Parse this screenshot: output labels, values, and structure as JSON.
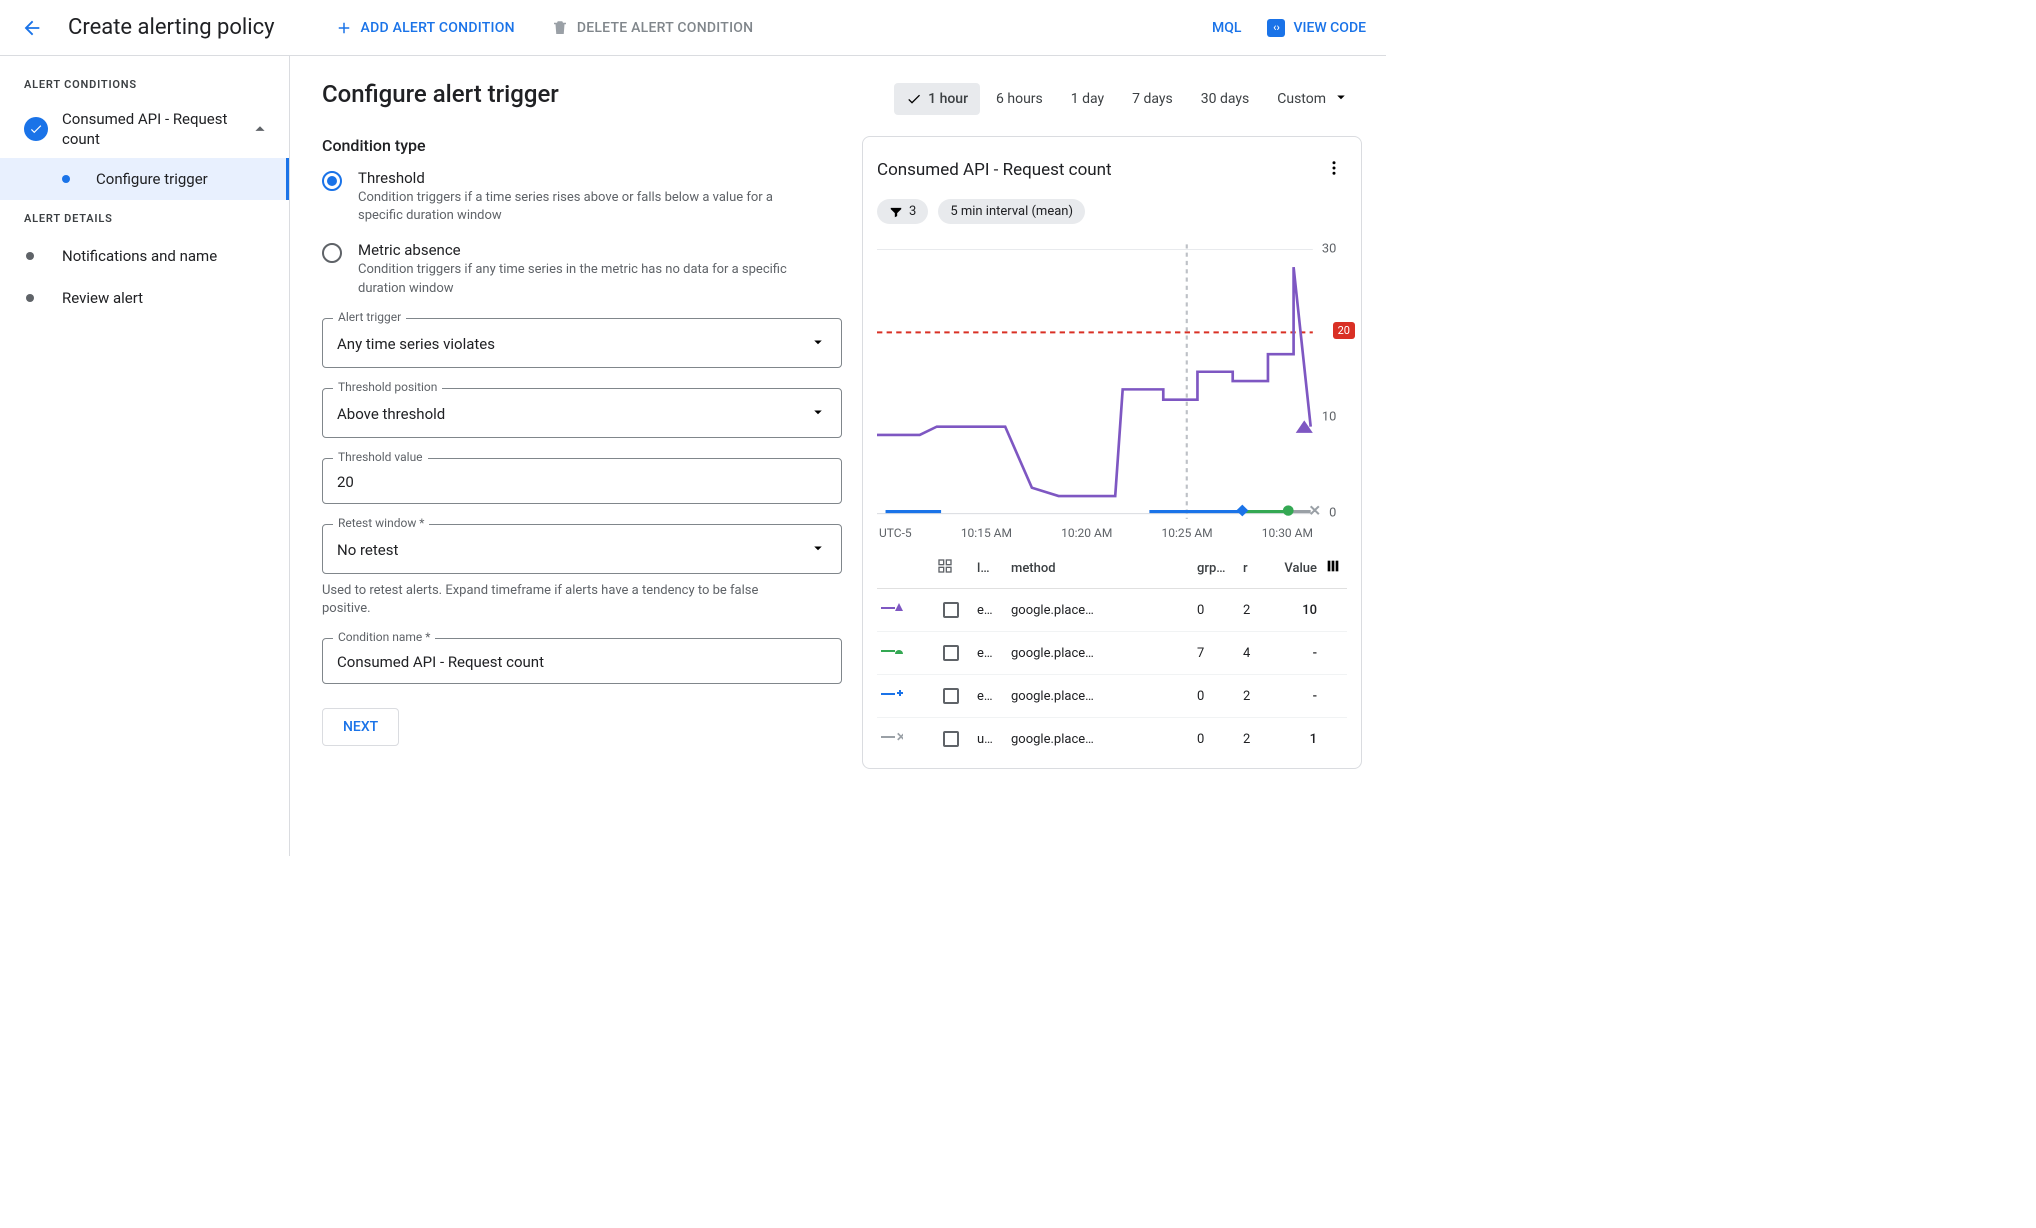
{
  "header": {
    "title": "Create alerting policy",
    "add_condition": "ADD ALERT CONDITION",
    "delete_condition": "DELETE ALERT CONDITION",
    "mql": "MQL",
    "view_code": "VIEW CODE"
  },
  "sidebar": {
    "conditions_heading": "ALERT CONDITIONS",
    "condition_title": "Consumed API - Request count",
    "configure_trigger": "Configure trigger",
    "details_heading": "ALERT DETAILS",
    "notifications_name": "Notifications and name",
    "review_alert": "Review alert"
  },
  "form": {
    "heading": "Configure alert trigger",
    "condition_type_heading": "Condition type",
    "threshold_label": "Threshold",
    "threshold_desc": "Condition triggers if a time series rises above or falls below a value for a specific duration window",
    "absence_label": "Metric absence",
    "absence_desc": "Condition triggers if any time series in the metric has no data for a specific duration window",
    "fields": {
      "alert_trigger": {
        "label": "Alert trigger",
        "value": "Any time series violates"
      },
      "threshold_position": {
        "label": "Threshold position",
        "value": "Above threshold"
      },
      "threshold_value": {
        "label": "Threshold value",
        "value": "20"
      },
      "retest": {
        "label": "Retest window *",
        "value": "No retest",
        "helper": "Used to retest alerts. Expand timeframe if alerts have a tendency to be false positive."
      },
      "condition_name": {
        "label": "Condition name *",
        "value": "Consumed API - Request count"
      }
    },
    "next": "NEXT"
  },
  "time_tabs": [
    "1 hour",
    "6 hours",
    "1 day",
    "7 days",
    "30 days"
  ],
  "time_custom": "Custom",
  "chart_panel": {
    "title": "Consumed API - Request count",
    "filter_count": "3",
    "interval_chip": "5 min interval (mean)",
    "timezone": "UTC-5",
    "x_ticks": [
      "10:15 AM",
      "10:20 AM",
      "10:25 AM",
      "10:30 AM"
    ],
    "y_ticks": [
      "30",
      "20",
      "10",
      "0"
    ],
    "threshold_badge": "20",
    "columns": {
      "c1": "l…",
      "c2": "method",
      "c3": "grp…",
      "c4": "r",
      "c5": "Value"
    },
    "rows": [
      {
        "marker_color": "#7e57c2",
        "marker_shape": "tri",
        "name": "e…",
        "method": "google.place…",
        "grp": "0",
        "r": "2",
        "value": "10"
      },
      {
        "marker_color": "#34a853",
        "marker_shape": "semi",
        "name": "e…",
        "method": "google.place…",
        "grp": "7",
        "r": "4",
        "value": "-"
      },
      {
        "marker_color": "#1a73e8",
        "marker_shape": "plus",
        "name": "e…",
        "method": "google.place…",
        "grp": "0",
        "r": "2",
        "value": "-"
      },
      {
        "marker_color": "#9aa0a6",
        "marker_shape": "x",
        "name": "u…",
        "method": "google.place…",
        "grp": "0",
        "r": "2",
        "value": "1"
      }
    ]
  },
  "chart_data": {
    "type": "line",
    "title": "Consumed API - Request count",
    "xlabel": "",
    "ylabel": "",
    "ylim": [
      0,
      30
    ],
    "threshold": 20,
    "x_ticks": [
      "10:15 AM",
      "10:20 AM",
      "10:25 AM",
      "10:30 AM"
    ],
    "series": [
      {
        "name": "e… google.place… (purple)",
        "color": "#7e57c2",
        "x": [
          0,
          0.1,
          0.14,
          0.18,
          0.3,
          0.36,
          0.42,
          0.55,
          0.57,
          0.66,
          0.66,
          0.74,
          0.74,
          0.82,
          0.82,
          0.9,
          0.9,
          0.96,
          0.96,
          1.0
        ],
        "y": [
          9,
          9,
          10,
          10,
          10,
          3,
          2,
          2,
          14,
          14,
          13,
          13,
          16,
          16,
          15,
          15,
          18,
          18,
          28,
          10
        ]
      },
      {
        "name": "e… google.place… (blue)",
        "color": "#1a73e8",
        "x": [
          0.0,
          0.15,
          0.62,
          0.83
        ],
        "y": [
          0,
          0,
          0,
          0
        ]
      },
      {
        "name": "e… google.place… (green)",
        "color": "#34a853",
        "x": [
          0.83,
          0.95
        ],
        "y": [
          0,
          0
        ]
      },
      {
        "name": "u… google.place… (grey)",
        "color": "#9aa0a6",
        "x": [
          0.95,
          1.0
        ],
        "y": [
          0,
          0
        ]
      }
    ]
  }
}
